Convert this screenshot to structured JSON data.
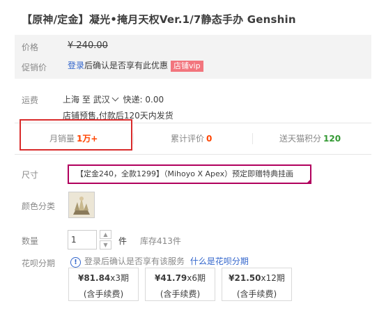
{
  "title": "【原神/定金】凝光•掩月天权Ver.1/7静态手办 Genshin",
  "price": {
    "label": "价格",
    "value": "¥ 240.00"
  },
  "promo": {
    "label": "促销价",
    "login_link": "登录",
    "text": "后确认是否享有此优惠",
    "vip_badge": "店铺vip"
  },
  "shipping": {
    "label": "运费",
    "from": "上海",
    "to_word": "至",
    "to": "武汉",
    "express": "快递: 0.00",
    "note": "店铺预售,付款后120天内发货"
  },
  "stats": {
    "monthly_sales": {
      "label": "月销量",
      "value": "1万+"
    },
    "reviews": {
      "label": "累计评价",
      "value": "0"
    },
    "points": {
      "label": "送天猫积分",
      "value": "120"
    }
  },
  "size": {
    "label": "尺寸",
    "selected": "【定金240，全款1299】（Mihoyo X Apex）预定即赠特典挂画"
  },
  "color": {
    "label": "颜色分类"
  },
  "quantity": {
    "label": "数量",
    "value": "1",
    "unit": "件",
    "stock": "库存413件"
  },
  "huabei": {
    "label": "花呗分期",
    "notice": "登录后确认是否享有该服务",
    "link": "什么是花呗分期",
    "plans": [
      {
        "amount": "¥81.84",
        "periods": "x3期",
        "fee": "(含手续费)"
      },
      {
        "amount": "¥41.79",
        "periods": "x6期",
        "fee": "(含手续费)"
      },
      {
        "amount": "¥21.50",
        "periods": "x12期",
        "fee": "(含手续费)"
      }
    ]
  },
  "colors": {
    "accent": "#ff4400",
    "link": "#3366cc",
    "highlight_box": "#d92b2b",
    "selected_border": "#b1005d",
    "green": "#339933"
  }
}
